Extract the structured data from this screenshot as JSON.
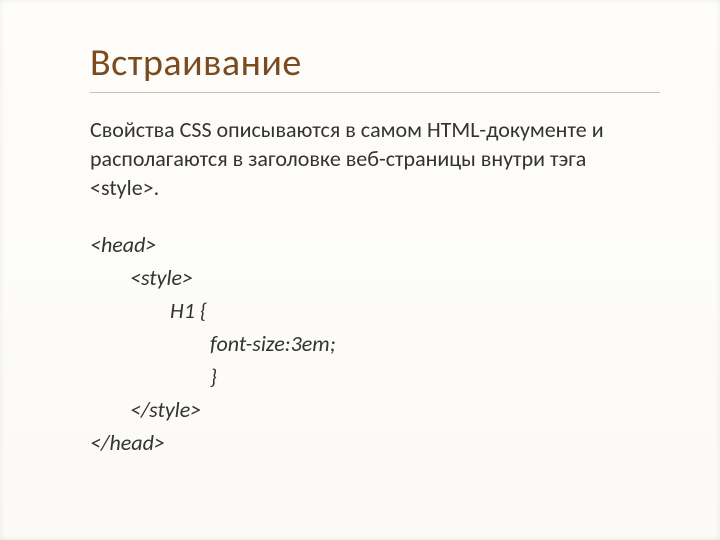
{
  "title": "Встраивание",
  "paragraph": "Свойства CSS описываются в самом HTML-документе и располагаются в заголовке веб-страницы внутри тэга <style>.",
  "code": {
    "l1": "<head>",
    "l2": "<style>",
    "l3": "H1 {",
    "l4": "font-size:3em;",
    "l5": "}",
    "l6": "</style>",
    "l7": "</head>"
  }
}
